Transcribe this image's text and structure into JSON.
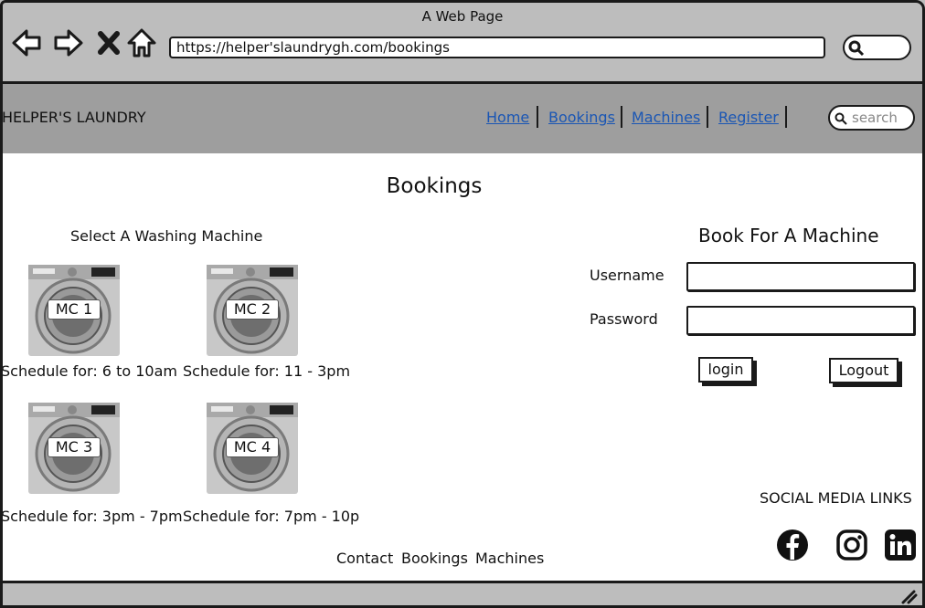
{
  "browser": {
    "window_title": "A Web Page",
    "url": "https://helper'slaundrygh.com/bookings",
    "icons": [
      "back-arrow-icon",
      "forward-arrow-icon",
      "close-icon",
      "home-icon",
      "search-icon"
    ]
  },
  "header": {
    "brand": "HELPER'S LAUNDRY",
    "nav": [
      {
        "label": "Home"
      },
      {
        "label": "Bookings"
      },
      {
        "label": "Machines"
      },
      {
        "label": "Register"
      }
    ],
    "search_placeholder": "search",
    "link_color": "#1a56b4",
    "background": "#9e9e9e"
  },
  "main": {
    "title": "Bookings",
    "select_heading": "Select A Washing Machine",
    "machines": [
      {
        "label": "MC 1",
        "schedule": "Schedule for: 6 to 10am"
      },
      {
        "label": "MC 2",
        "schedule": "Schedule for: 11 - 3pm"
      },
      {
        "label": "MC 3",
        "schedule": "Schedule for: 3pm - 7pm"
      },
      {
        "label": "MC 4",
        "schedule": "Schedule for: 7pm - 10p"
      }
    ]
  },
  "booking_form": {
    "heading": "Book For A Machine",
    "username_label": "Username",
    "username_value": "",
    "password_label": "Password",
    "password_value": "",
    "login_label": "login",
    "logout_label": "Logout"
  },
  "social": {
    "title": "SOCIAL MEDIA LINKS",
    "icons": [
      "facebook-icon",
      "instagram-icon",
      "linkedin-icon"
    ]
  },
  "footer": {
    "links": [
      {
        "label": "Contact"
      },
      {
        "label": "Bookings"
      },
      {
        "label": "Machines"
      }
    ]
  }
}
